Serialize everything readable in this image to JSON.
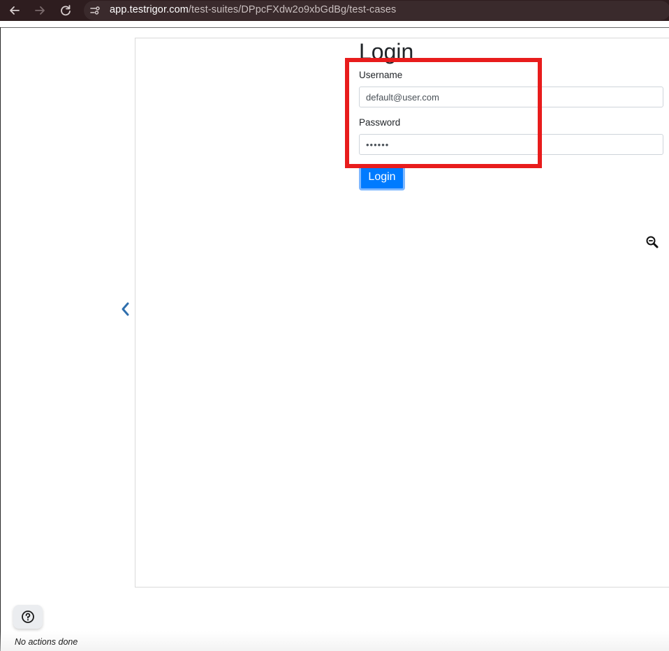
{
  "browser": {
    "url_host": "app.testrigor.com",
    "url_path": "/test-suites/DPpcFXdw2o9xbGdBg/test-cases",
    "back_icon": "back-arrow-icon",
    "forward_icon": "forward-arrow-icon",
    "reload_icon": "reload-icon",
    "site_info_icon": "site-settings-icon"
  },
  "login_form": {
    "title": "Login",
    "username_label": "Username",
    "username_value": "default@user.com",
    "password_label": "Password",
    "password_value": "••••••",
    "submit_label": "Login"
  },
  "highlight": {
    "color": "#e81c1c"
  },
  "icons": {
    "zoom_out": "zoom-out-icon",
    "collapse": "chevron-left-icon",
    "help": "help-circle-icon"
  },
  "status": {
    "text": "No actions done"
  },
  "colors": {
    "primary_button": "#007bff",
    "browser_bar": "#2e1d1f",
    "chevron": "#2f6fad"
  }
}
